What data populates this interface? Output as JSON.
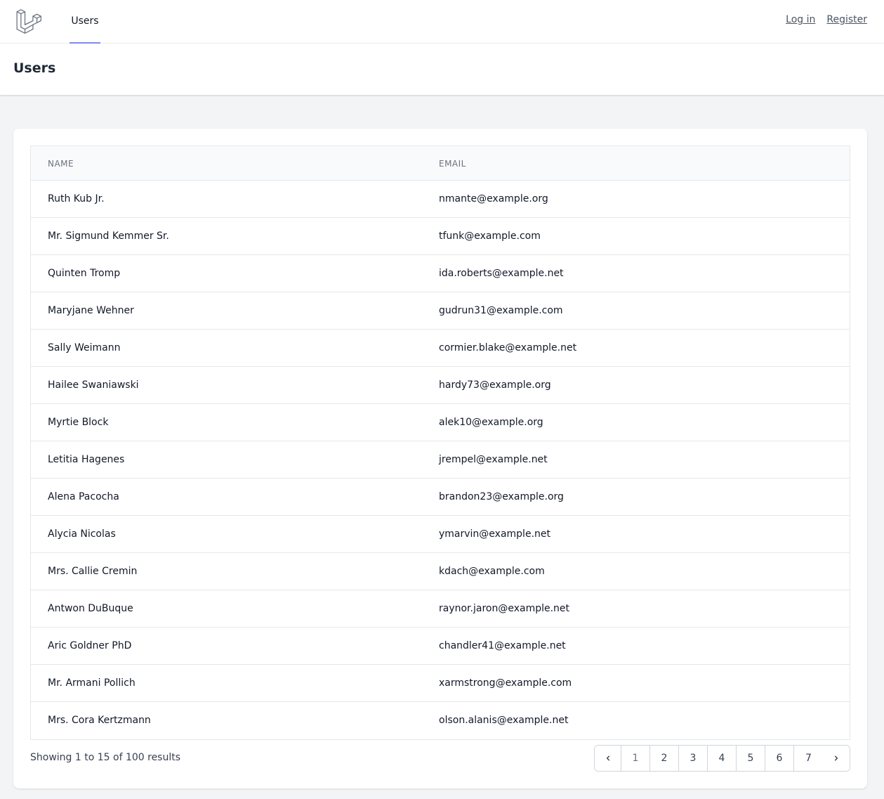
{
  "nav": {
    "active_link": "Users",
    "login": "Log in",
    "register": "Register"
  },
  "header": {
    "title": "Users"
  },
  "table": {
    "columns": [
      "Name",
      "Email"
    ],
    "rows": [
      {
        "name": "Ruth Kub Jr.",
        "email": "nmante@example.org"
      },
      {
        "name": "Mr. Sigmund Kemmer Sr.",
        "email": "tfunk@example.com"
      },
      {
        "name": "Quinten Tromp",
        "email": "ida.roberts@example.net"
      },
      {
        "name": "Maryjane Wehner",
        "email": "gudrun31@example.com"
      },
      {
        "name": "Sally Weimann",
        "email": "cormier.blake@example.net"
      },
      {
        "name": "Hailee Swaniawski",
        "email": "hardy73@example.org"
      },
      {
        "name": "Myrtie Block",
        "email": "alek10@example.org"
      },
      {
        "name": "Letitia Hagenes",
        "email": "jrempel@example.net"
      },
      {
        "name": "Alena Pacocha",
        "email": "brandon23@example.org"
      },
      {
        "name": "Alycia Nicolas",
        "email": "ymarvin@example.net"
      },
      {
        "name": "Mrs. Callie Cremin",
        "email": "kdach@example.com"
      },
      {
        "name": "Antwon DuBuque",
        "email": "raynor.jaron@example.net"
      },
      {
        "name": "Aric Goldner PhD",
        "email": "chandler41@example.net"
      },
      {
        "name": "Mr. Armani Pollich",
        "email": "xarmstrong@example.com"
      },
      {
        "name": "Mrs. Cora Kertzmann",
        "email": "olson.alanis@example.net"
      }
    ]
  },
  "pagination": {
    "summary": "Showing 1 to 15 of 100 results",
    "pages": [
      "1",
      "2",
      "3",
      "4",
      "5",
      "6",
      "7"
    ],
    "current": "1"
  }
}
